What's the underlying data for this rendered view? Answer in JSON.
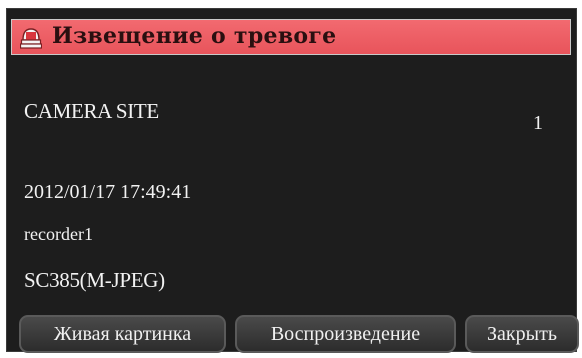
{
  "dialog": {
    "title": "Извещение о тревоге",
    "icon": "alarm-light-icon"
  },
  "alarm": {
    "site_name": "CAMERA SITE",
    "site_number": "1",
    "datetime": "2012/01/17 17:49:41",
    "recorder": "recorder1",
    "camera_model": "SC385(M-JPEG)"
  },
  "buttons": {
    "live_label": "Живая картинка",
    "playback_label": "Воспроизведение",
    "close_label": "Закрыть"
  },
  "colors": {
    "title_bar": "#e8545b",
    "background": "#1d1d1d",
    "text": "#f2f2f2"
  }
}
